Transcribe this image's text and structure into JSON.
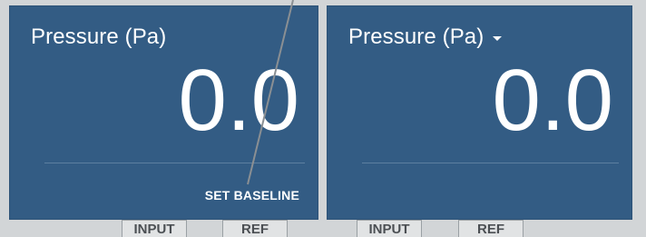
{
  "panels": [
    {
      "title": "Pressure (Pa)",
      "value": "0.0",
      "action_label": "SET BASELINE"
    },
    {
      "title": "Pressure (Pa)",
      "value": "0.0",
      "has_dropdown": true
    }
  ],
  "tabs": [
    {
      "label": "INPUT"
    },
    {
      "label": "REF"
    },
    {
      "label": "INPUT"
    },
    {
      "label": "REF"
    }
  ],
  "colors": {
    "panel_bg": "#335c84",
    "text": "#ffffff",
    "page_bg": "#d2d5d7",
    "pointer_line": "#8a8f93"
  },
  "icons": {
    "dropdown": "chevron-down-icon"
  }
}
